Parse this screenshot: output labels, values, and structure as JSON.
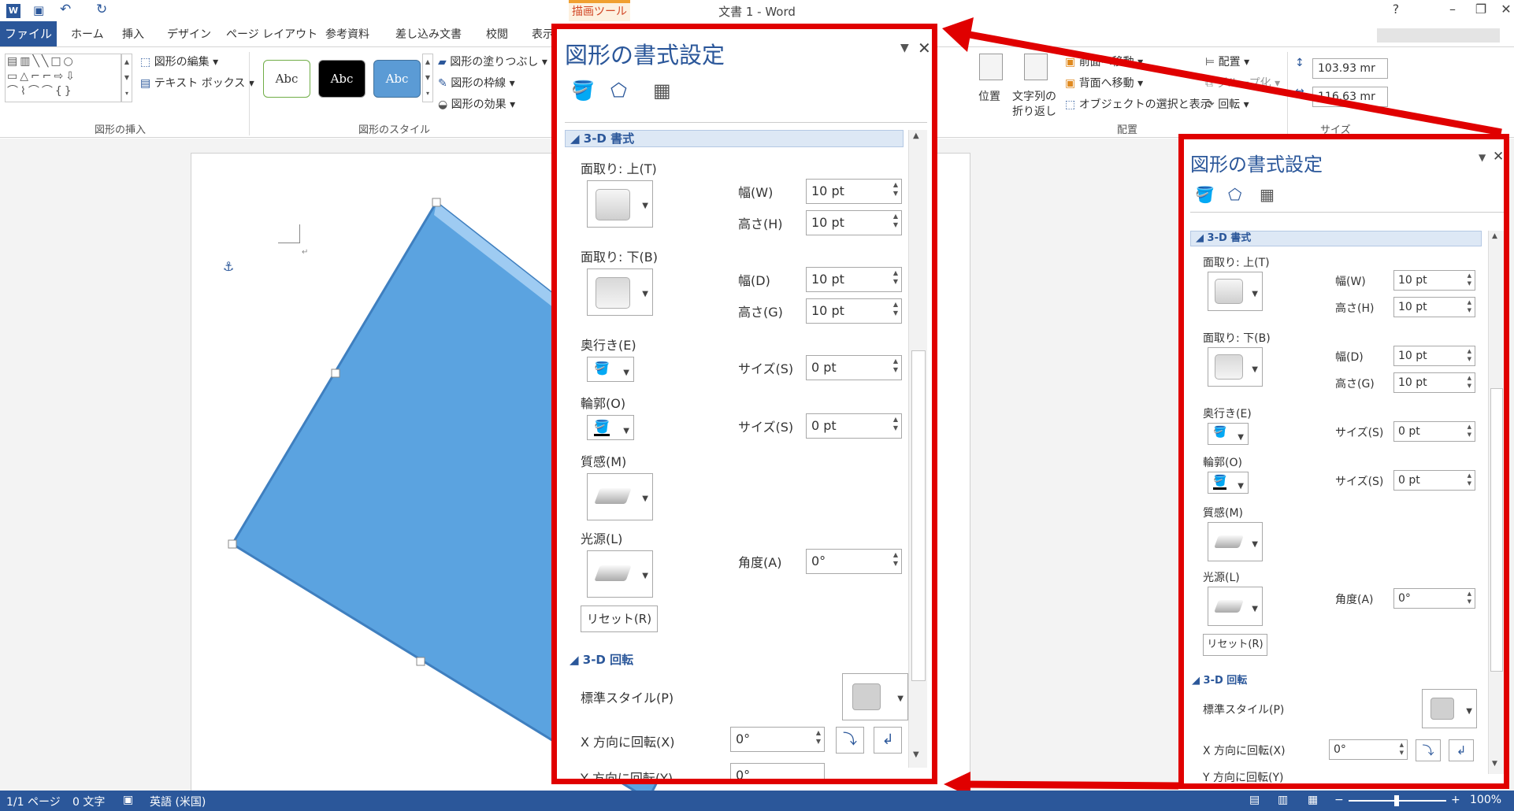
{
  "window": {
    "title": "文書 1 - Word",
    "context_tab": "描画ツール",
    "help": "?",
    "minimize": "–",
    "restore": "❐",
    "close": "✕"
  },
  "tabs": {
    "file": "ファイル",
    "items": [
      "ホーム",
      "挿入",
      "デザイン",
      "ページ レイアウト",
      "参考資料",
      "差し込み文書",
      "校閲",
      "表示"
    ]
  },
  "ribbon": {
    "insert_group": {
      "label": "図形の挿入",
      "edit_shape": "図形の編集",
      "text_box": "テキスト ボックス"
    },
    "style_group": {
      "label": "図形のスタイル",
      "abc": "Abc",
      "fill": "図形の塗りつぶし",
      "outline": "図形の枠線",
      "effects": "図形の効果"
    },
    "arrange_group": {
      "label": "配置",
      "position": "位置",
      "wrap1": "文字列の",
      "wrap2": "折り返し",
      "forward": "前面へ移動",
      "backward": "背面へ移動",
      "selection": "オブジェクトの選択と表示",
      "align": "配置",
      "group": "グループ化",
      "rotate": "回転"
    },
    "size_group": {
      "label": "サイズ",
      "height": "103.93 mr",
      "width": "116.63 mr"
    }
  },
  "pane": {
    "title": "図形の書式設定",
    "bevel_top": "面取り: 上(T)",
    "bevel_bottom": "面取り: 下(B)",
    "width_w": "幅(W)",
    "height_h": "高さ(H)",
    "width_d": "幅(D)",
    "height_g": "高さ(G)",
    "v_10": "10 pt",
    "v_0": "0 pt",
    "v_0deg": "0°",
    "depth": "奥行き(E)",
    "contour": "輪郭(O)",
    "size_s": "サイズ(S)",
    "material": "質感(M)",
    "lighting": "光源(L)",
    "angle": "角度(A)",
    "reset": "リセット(R)",
    "sec_3d_format": "3-D 書式",
    "sec_3d_rotation": "3-D 回転",
    "preset": "標準スタイル(P)",
    "x_rot": "X 方向に回転(X)",
    "y_rot": "Y 方向に回転(Y)"
  },
  "status": {
    "page": "1/1 ページ",
    "words": "0 文字",
    "lang": "英語 (米国)",
    "zoom": "100%"
  },
  "colors": {
    "accent": "#2b579a",
    "highlight": "#e00000",
    "shape": "#5ba3e0",
    "ctx": "#d24726"
  }
}
